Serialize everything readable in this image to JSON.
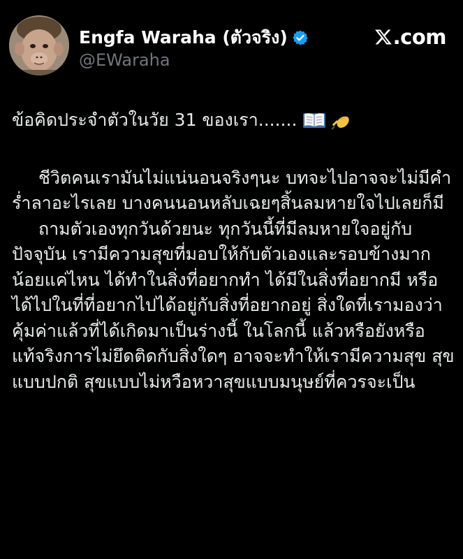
{
  "author": {
    "display_name": "Engfa Waraha (ตัวจริง)",
    "handle": "@EWaraha",
    "verified_icon": "verified-badge-icon",
    "accent_color": "#1d9bf0"
  },
  "branding": {
    "site_label": ".com",
    "logo_icon": "x-logo-icon"
  },
  "tweet": {
    "intro": "ข้อคิดประจำตัวในวัย 31 ของเรา.......",
    "intro_icons": [
      "open-book-icon",
      "writing-hand-icon"
    ],
    "paragraph_1": "ชีวิตคนเรามันไม่แน่นอนจริงๆนะ บทจะไปอาจจะไม่มีคำร่ำลาอะไรเลย บางคนนอนหลับเฉยๆสิ้นลมหายใจไปเลยก็มี",
    "paragraph_2": "ถามตัวเองทุกวันด้วยนะ ทุกวันนี้ที่มีลมหายใจอยู่กับปัจจุบัน เรามีความสุขที่มอบให้กับตัวเองและรอบข้างมากน้อยแค่ไหน ได้ทำในสิ่งที่อยากทำ ได้มีในสิ่งที่อยากมี หรือได้ไปในที่ที่อยากไปได้อยู่กับสิ่งที่อยากอยู่ สิ่งใดที่เรามองว่าคุ้มค่าแล้วที่ได้เกิดมาเป็นร่างนี้ ในโลกนี้ แล้วหรือยังหรือแท้จริงการไม่ยึดติดกับสิ่งใดๆ อาจจะทำให้เรามีความสุข สุขแบบปกติ สุขแบบไม่หวือหวาสุขแบบมนุษย์ที่ควรจะเป็น"
  }
}
